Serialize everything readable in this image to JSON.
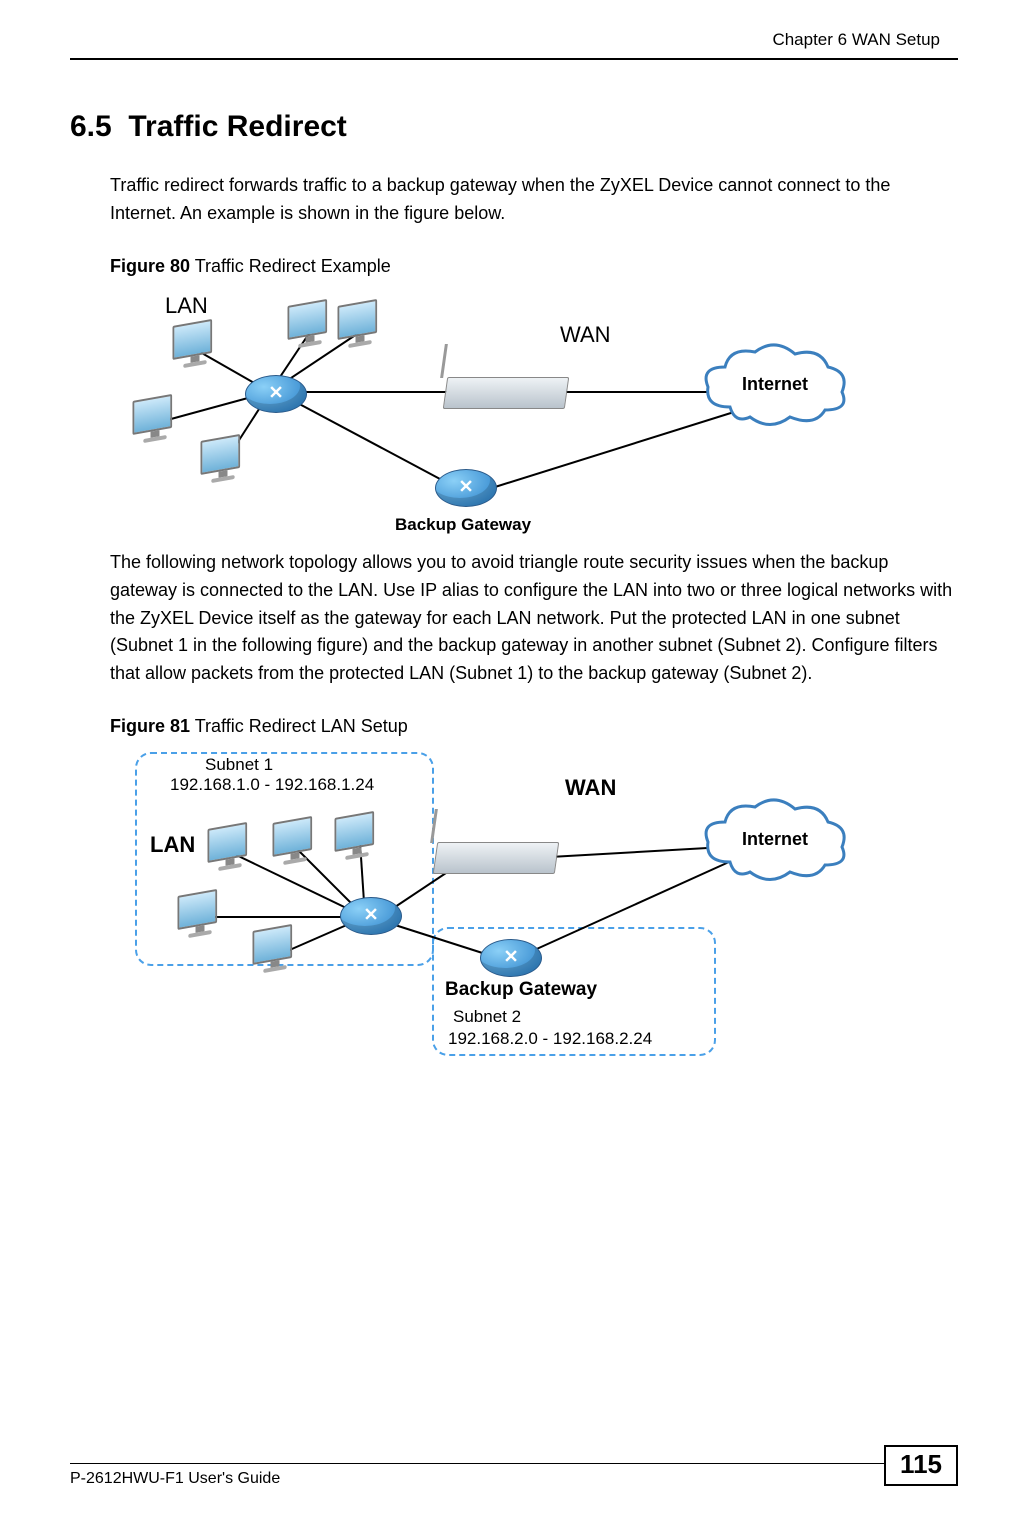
{
  "chapter_header": "Chapter 6 WAN Setup",
  "section_number": "6.5",
  "section_title": "Traffic Redirect",
  "para1": "Traffic redirect forwards traffic to a backup gateway when the ZyXEL Device cannot connect to the Internet. An example is shown in the figure below.",
  "figure80": {
    "label_bold": "Figure 80",
    "label_rest": "   Traffic Redirect Example",
    "lan": "LAN",
    "wan": "WAN",
    "internet": "Internet",
    "backup": "Backup Gateway"
  },
  "para2": "The following network topology allows you to avoid triangle route security issues when the backup gateway is connected to the LAN. Use IP alias to configure the LAN into two or three logical networks with the ZyXEL Device itself as the gateway for each LAN network. Put the protected LAN in one subnet (Subnet 1 in the following figure) and the backup gateway in another subnet (Subnet 2). Configure filters that allow packets from the protected LAN (Subnet 1) to the backup gateway (Subnet 2).",
  "figure81": {
    "label_bold": "Figure 81",
    "label_rest": "   Traffic Redirect LAN Setup",
    "lan": "LAN",
    "wan": "WAN",
    "internet": "Internet",
    "backup": "Backup Gateway",
    "subnet1_name": "Subnet 1",
    "subnet1_range": "192.168.1.0 - 192.168.1.24",
    "subnet2_name": "Subnet 2",
    "subnet2_range": "192.168.2.0 - 192.168.2.24"
  },
  "footer_guide": "P-2612HWU-F1 User's Guide",
  "footer_page": "115"
}
